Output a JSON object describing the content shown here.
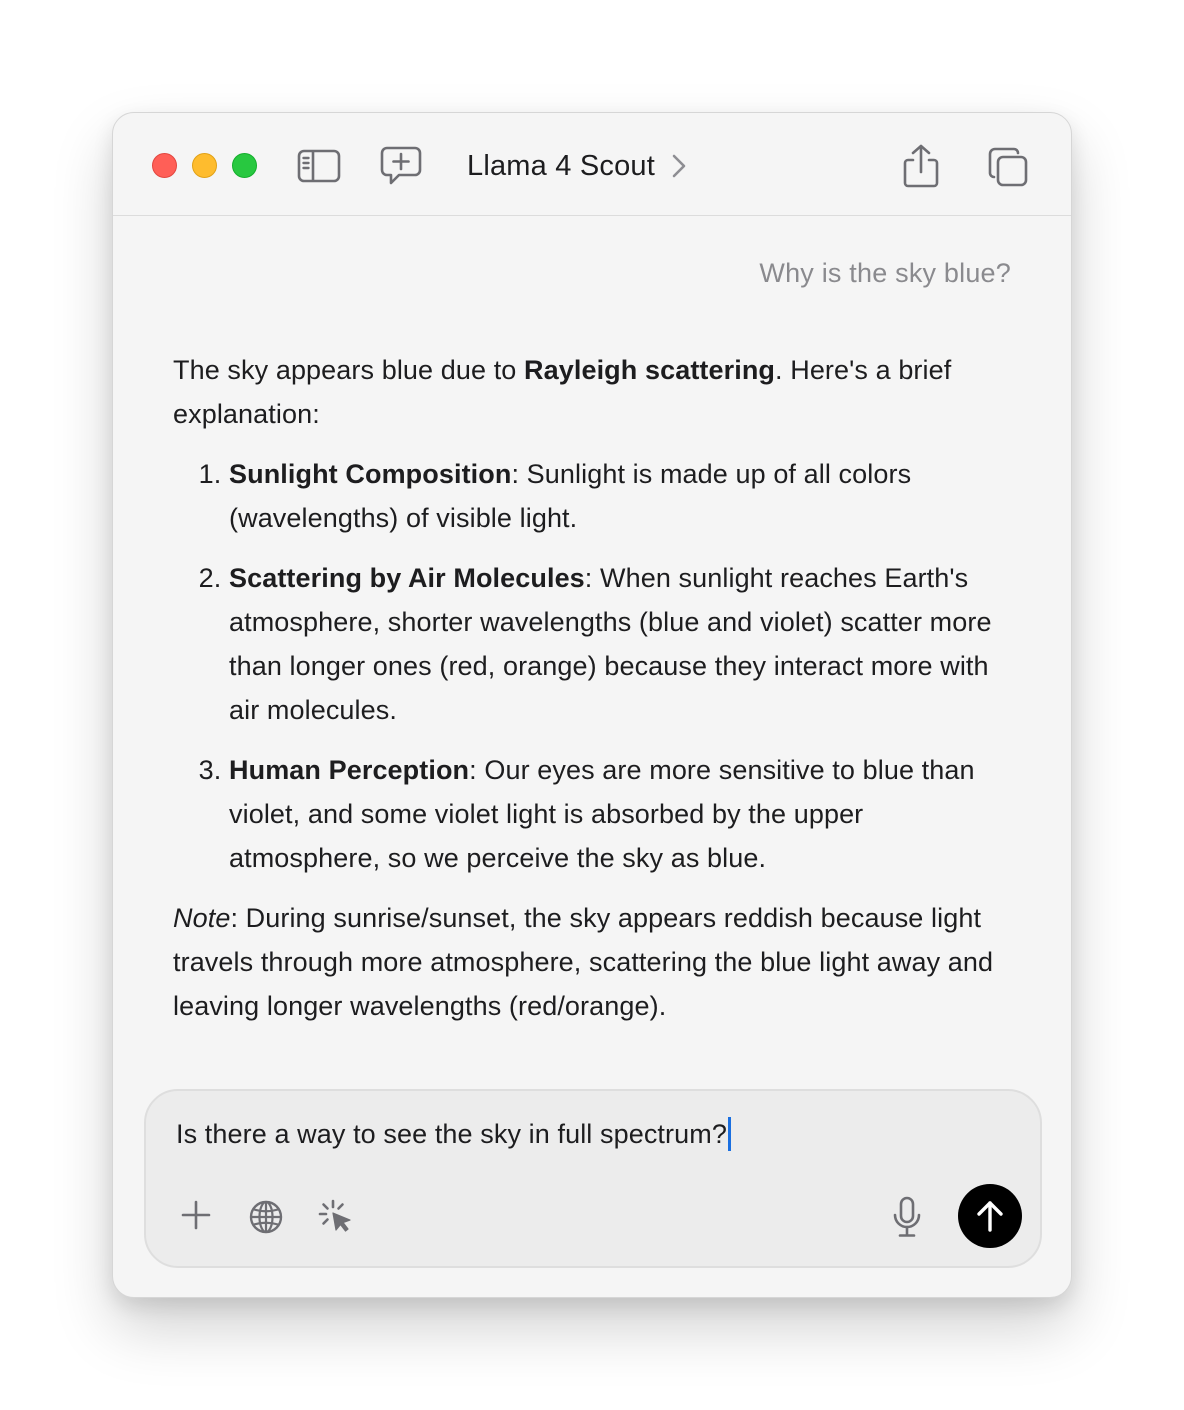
{
  "window": {
    "title": "Llama 4 Scout"
  },
  "conversation": {
    "user_message": "Why is the sky blue?",
    "answer": {
      "intro_before": "The sky appears blue due to ",
      "intro_bold": "Rayleigh scattering",
      "intro_after": ". Here's a brief explanation:",
      "list": [
        {
          "heading": "Sunlight Composition",
          "text": ": Sunlight is made up of all colors (wavelengths) of visible light."
        },
        {
          "heading": "Scattering by Air Molecules",
          "text": ": When sunlight reaches Earth's atmosphere, shorter wavelengths (blue and violet) scatter more than longer ones (red, orange) because they interact more with air molecules."
        },
        {
          "heading": "Human Perception",
          "text": ": Our eyes are more sensitive to blue than violet, and some violet light is absorbed by the upper atmosphere, so we perceive the sky as blue."
        }
      ],
      "note_label": "Note",
      "note_text": ": During sunrise/sunset, the sky appears reddish because light travels through more atmosphere, scattering the blue light away and leaving longer wavelengths (red/orange)."
    }
  },
  "composer": {
    "input_value": "Is there a way to see the sky in full spectrum?"
  },
  "icons": {
    "sidebar": "sidebar-icon",
    "new_chat": "new-chat-icon",
    "title_chevron": "chevron-right-icon",
    "share": "share-icon",
    "copy": "copy-window-icon",
    "add": "plus-icon",
    "web": "globe-icon",
    "tools": "sparkle-cursor-icon",
    "mic": "microphone-icon",
    "send": "arrow-up-icon"
  },
  "colors": {
    "close": "#ff5f57",
    "minimize": "#febc2e",
    "maximize": "#28c840",
    "caret": "#1a6fe0",
    "send_button": "#000000"
  }
}
